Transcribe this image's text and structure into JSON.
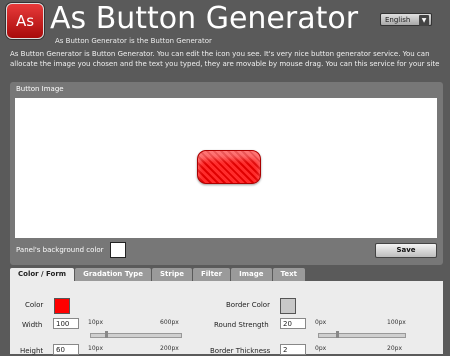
{
  "header": {
    "logo_text": "As",
    "title": "As Button Generator",
    "language": "English",
    "subtitle": "As Button Generator is the Button Generator",
    "description": "As Button Generator is Button Generator. You can edit the icon you see. It's very nice button generator service. You can allocate the image you chosen and the text you typed, they are movable by mouse drag. You can this service for your site"
  },
  "panel": {
    "title": "Button Image",
    "bg_label": "Panel's background color",
    "bg_color": "#ffffff",
    "save_label": "Save"
  },
  "tabs": [
    "Color / Form",
    "Gradation Type",
    "Stripe",
    "Filter",
    "Image",
    "Text"
  ],
  "form": {
    "color_label": "Color",
    "color_value": "#ff0000",
    "border_color_label": "Border Color",
    "border_color_value": "#c8c8c8",
    "width_label": "Width",
    "width_value": "100",
    "width_min": "10px",
    "width_max": "600px",
    "width_fraction": 0.15,
    "round_label": "Round Strength",
    "round_value": "20",
    "round_min": "0px",
    "round_max": "100px",
    "round_fraction": 0.2,
    "height_label": "Height",
    "height_value": "60",
    "height_min": "10px",
    "height_max": "200px",
    "border_thickness_label": "Border Thickness",
    "border_thickness_value": "2",
    "border_min": "0px",
    "border_max": "20px"
  }
}
